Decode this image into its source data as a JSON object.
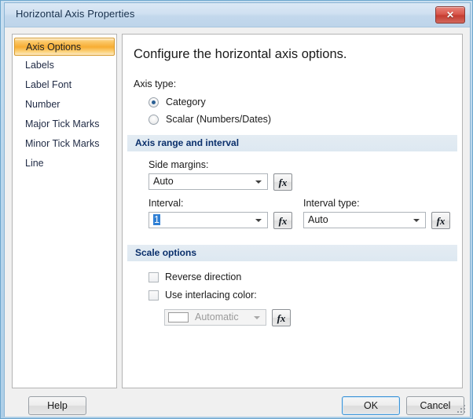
{
  "window": {
    "title": "Horizontal Axis Properties",
    "close_icon": "close-x-icon"
  },
  "sidebar": {
    "items": [
      {
        "label": "Axis Options",
        "selected": true
      },
      {
        "label": "Labels",
        "selected": false
      },
      {
        "label": "Label Font",
        "selected": false
      },
      {
        "label": "Number",
        "selected": false
      },
      {
        "label": "Major Tick Marks",
        "selected": false
      },
      {
        "label": "Minor Tick Marks",
        "selected": false
      },
      {
        "label": "Line",
        "selected": false
      }
    ]
  },
  "content": {
    "heading": "Configure the horizontal axis options.",
    "axis_type": {
      "label": "Axis type:",
      "options": [
        {
          "label": "Category",
          "checked": true
        },
        {
          "label": "Scalar (Numbers/Dates)",
          "checked": false
        }
      ]
    },
    "axis_range_section": {
      "header": "Axis range and interval",
      "side_margins": {
        "label": "Side margins:",
        "value": "Auto",
        "fx_label": "fx"
      },
      "interval": {
        "label": "Interval:",
        "value": "1",
        "fx_label": "fx"
      },
      "interval_type": {
        "label": "Interval type:",
        "value": "Auto",
        "fx_label": "fx"
      }
    },
    "scale_section": {
      "header": "Scale options",
      "reverse_direction": {
        "label": "Reverse direction",
        "checked": false
      },
      "use_interlacing_color": {
        "label": "Use interlacing color:",
        "checked": false
      },
      "interlacing_color": {
        "value": "Automatic",
        "swatch_color": "#ffffff",
        "disabled": true,
        "fx_label": "fx"
      }
    }
  },
  "footer": {
    "help_label": "Help",
    "ok_label": "OK",
    "cancel_label": "Cancel"
  },
  "colors": {
    "accent_selected": "#f7ad33",
    "section_header_text": "#0a2f6b",
    "selection_blue": "#2f7fd4",
    "title_bar": "#cfe0f1",
    "close_button_red": "#c53c31"
  }
}
